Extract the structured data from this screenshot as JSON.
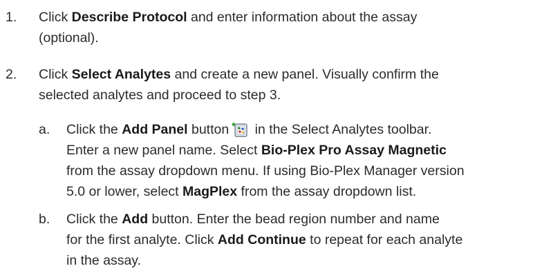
{
  "step1": {
    "number": "1.",
    "pre": "Click ",
    "bold": "Describe Protocol",
    "post": " and enter information about the assay",
    "line2": "(optional)."
  },
  "step2": {
    "number": "2.",
    "pre": "Click ",
    "bold": "Select Analytes",
    "post": " and create a new panel. Visually confirm the",
    "line2": "selected analytes and proceed to step 3."
  },
  "step2a": {
    "letter": "a.",
    "l1_pre": "Click the ",
    "l1_bold": "Add Panel",
    "l1_mid": " button",
    "l1_post": " in the Select Analytes toolbar.",
    "l2_pre": "Enter a new panel name. Select ",
    "l2_bold": "Bio-Plex Pro Assay Magnetic",
    "l3": "from the assay dropdown menu. If using Bio-Plex Manager version",
    "l4_pre": "5.0 or lower, select ",
    "l4_bold": "MagPlex",
    "l4_post": " from the assay dropdown list.",
    "icon": "add-panel-icon"
  },
  "step2b": {
    "letter": "b.",
    "l1_pre": "Click the ",
    "l1_bold": "Add",
    "l1_post": " button. Enter the bead region number and name",
    "l2_pre": "for the first analyte. Click ",
    "l2_bold": "Add Continue",
    "l2_post": " to repeat for each analyte",
    "l3": "in the assay."
  }
}
